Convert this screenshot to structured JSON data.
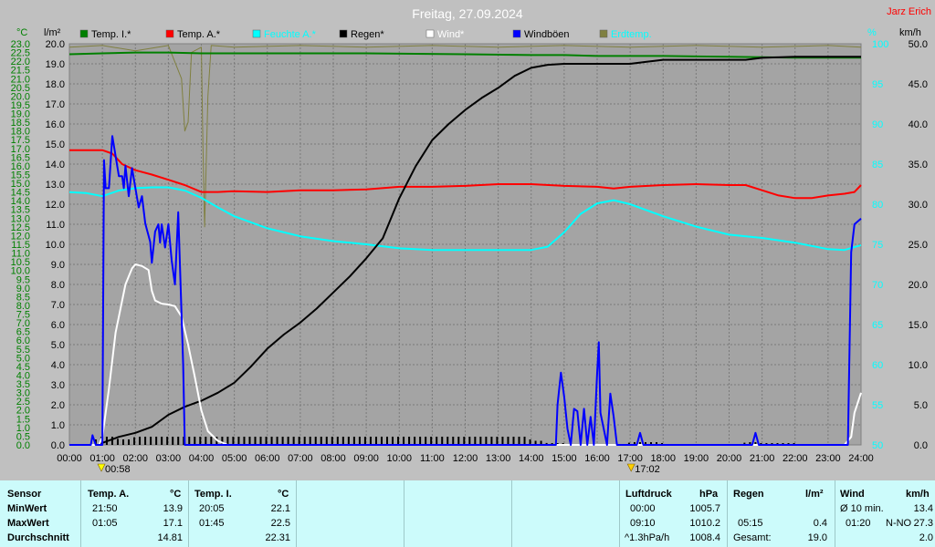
{
  "header": {
    "title": "Freitag, 27.09.2024",
    "author": "Jarz Erich"
  },
  "chart_data": {
    "type": "line",
    "title": "Freitag, 27.09.2024",
    "axes": {
      "temp": {
        "unit": "°C",
        "min": 0,
        "max": 23,
        "step": 0.5,
        "ticks": [
          "0.0",
          "0.5",
          "1.0",
          "1.5",
          "2.0",
          "2.5",
          "3.0",
          "3.5",
          "4.0",
          "4.5",
          "5.0",
          "5.5",
          "6.0",
          "6.5",
          "7.0",
          "7.5",
          "8.0",
          "8.5",
          "9.0",
          "9.5",
          "10.0",
          "10.5",
          "11.0",
          "11.5",
          "12.0",
          "12.5",
          "13.0",
          "13.5",
          "14.0",
          "14.5",
          "15.0",
          "15.5",
          "16.0",
          "16.5",
          "17.0",
          "17.5",
          "18.0",
          "18.5",
          "19.0",
          "19.5",
          "20.0",
          "20.5",
          "21.0",
          "21.5",
          "22.0",
          "22.5",
          "23.0"
        ],
        "color": "#008000"
      },
      "rain": {
        "unit": "l/m²",
        "min": 0,
        "max": 20,
        "step": 1,
        "ticks": [
          "0.0",
          "1.0",
          "2.0",
          "3.0",
          "4.0",
          "5.0",
          "6.0",
          "7.0",
          "8.0",
          "9.0",
          "10.0",
          "11.0",
          "12.0",
          "13.0",
          "14.0",
          "15.0",
          "16.0",
          "17.0",
          "18.0",
          "19.0",
          "20.0"
        ],
        "color": "#000000"
      },
      "humidity": {
        "unit": "%",
        "min": 50,
        "max": 100,
        "step": 5,
        "ticks": [
          "50",
          "55",
          "60",
          "65",
          "70",
          "75",
          "80",
          "85",
          "90",
          "95",
          "100"
        ],
        "color": "#00ffff"
      },
      "wind": {
        "unit": "km/h",
        "min": 0,
        "max": 50,
        "step": 5,
        "ticks": [
          "0.0",
          "5.0",
          "10.0",
          "15.0",
          "20.0",
          "25.0",
          "30.0",
          "35.0",
          "40.0",
          "45.0",
          "50.0"
        ],
        "color": "#000000"
      },
      "x_ticks": [
        "00:00",
        "01:00",
        "02:00",
        "03:00",
        "04:00",
        "05:00",
        "06:00",
        "07:00",
        "08:00",
        "09:00",
        "10:00",
        "11:00",
        "12:00",
        "13:00",
        "14:00",
        "15:00",
        "16:00",
        "17:00",
        "18:00",
        "19:00",
        "20:00",
        "21:00",
        "22:00",
        "23:00",
        "24:00"
      ]
    },
    "legend": [
      {
        "name": "Temp. I.*",
        "color": "#008000"
      },
      {
        "name": "Temp. A.*",
        "color": "#ff0000"
      },
      {
        "name": "Feuchte A.*",
        "color": "#00ffff"
      },
      {
        "name": "Regen*",
        "color": "#000000"
      },
      {
        "name": "Wind*",
        "color": "#ffffff"
      },
      {
        "name": "Windböen",
        "color": "#0000ff"
      },
      {
        "name": "Erdtemp.",
        "color": "#808040"
      }
    ],
    "markers": [
      {
        "label": "00:58",
        "time": 0.97,
        "kind": "sunrise"
      },
      {
        "label": "17:02",
        "time": 17.03,
        "kind": "sunset"
      }
    ],
    "series": [
      {
        "name": "Temp. I.*",
        "axis": "temp",
        "color": "#008000",
        "points": [
          [
            0,
            22.4
          ],
          [
            1,
            22.45
          ],
          [
            2,
            22.5
          ],
          [
            3,
            22.5
          ],
          [
            4,
            22.45
          ],
          [
            6,
            22.45
          ],
          [
            9,
            22.45
          ],
          [
            12,
            22.4
          ],
          [
            14,
            22.35
          ],
          [
            15,
            22.35
          ],
          [
            16,
            22.3
          ],
          [
            18,
            22.3
          ],
          [
            20,
            22.25
          ],
          [
            22,
            22.2
          ],
          [
            24,
            22.2
          ]
        ]
      },
      {
        "name": "Temp. A.*",
        "axis": "temp",
        "color": "#ff0000",
        "points": [
          [
            0,
            16.9
          ],
          [
            0.5,
            16.9
          ],
          [
            1,
            16.9
          ],
          [
            1.3,
            16.7
          ],
          [
            1.6,
            16.1
          ],
          [
            2,
            15.75
          ],
          [
            2.5,
            15.5
          ],
          [
            3,
            15.2
          ],
          [
            3.5,
            14.9
          ],
          [
            4,
            14.5
          ],
          [
            4.5,
            14.5
          ],
          [
            5,
            14.55
          ],
          [
            6,
            14.5
          ],
          [
            7,
            14.6
          ],
          [
            8,
            14.6
          ],
          [
            9,
            14.65
          ],
          [
            10,
            14.8
          ],
          [
            11,
            14.8
          ],
          [
            12,
            14.85
          ],
          [
            13,
            14.95
          ],
          [
            14,
            14.95
          ],
          [
            15,
            14.85
          ],
          [
            16,
            14.8
          ],
          [
            16.5,
            14.7
          ],
          [
            17,
            14.8
          ],
          [
            18,
            14.9
          ],
          [
            19,
            14.95
          ],
          [
            20,
            14.9
          ],
          [
            20.5,
            14.9
          ],
          [
            21,
            14.6
          ],
          [
            21.5,
            14.3
          ],
          [
            22,
            14.15
          ],
          [
            22.5,
            14.15
          ],
          [
            23,
            14.3
          ],
          [
            23.5,
            14.4
          ],
          [
            23.8,
            14.5
          ],
          [
            24,
            14.9
          ]
        ]
      },
      {
        "name": "Feuchte A.*",
        "axis": "humidity",
        "color": "#00ffff",
        "points": [
          [
            0,
            81.5
          ],
          [
            0.5,
            81.4
          ],
          [
            1,
            81
          ],
          [
            1.5,
            81.7
          ],
          [
            2,
            82
          ],
          [
            2.5,
            82.1
          ],
          [
            3,
            82.1
          ],
          [
            3.5,
            81.7
          ],
          [
            4,
            80.8
          ],
          [
            4.5,
            79.6
          ],
          [
            5,
            78.5
          ],
          [
            6,
            77
          ],
          [
            7,
            76
          ],
          [
            8,
            75.4
          ],
          [
            9,
            75
          ],
          [
            10,
            74.5
          ],
          [
            11,
            74.3
          ],
          [
            12,
            74.3
          ],
          [
            13,
            74.3
          ],
          [
            14,
            74.3
          ],
          [
            14.5,
            74.7
          ],
          [
            15,
            76.5
          ],
          [
            15.5,
            78.8
          ],
          [
            16,
            80.1
          ],
          [
            16.5,
            80.5
          ],
          [
            17,
            80
          ],
          [
            18,
            78.5
          ],
          [
            19,
            77.2
          ],
          [
            20,
            76.2
          ],
          [
            21,
            75.8
          ],
          [
            22,
            75.2
          ],
          [
            23,
            74.4
          ],
          [
            23.5,
            74.3
          ],
          [
            24,
            74.9
          ]
        ]
      },
      {
        "name": "Regen*",
        "axis": "rain",
        "color": "#000000",
        "points": [
          [
            0,
            0
          ],
          [
            0.9,
            0
          ],
          [
            1,
            0.1
          ],
          [
            1.5,
            0.4
          ],
          [
            2,
            0.6
          ],
          [
            2.5,
            0.9
          ],
          [
            3,
            1.5
          ],
          [
            3.5,
            1.9
          ],
          [
            4,
            2.2
          ],
          [
            4.5,
            2.6
          ],
          [
            5,
            3.1
          ],
          [
            5.5,
            3.9
          ],
          [
            6,
            4.8
          ],
          [
            6.5,
            5.5
          ],
          [
            7,
            6.1
          ],
          [
            7.5,
            6.8
          ],
          [
            8,
            7.6
          ],
          [
            8.5,
            8.4
          ],
          [
            9,
            9.3
          ],
          [
            9.5,
            10.3
          ],
          [
            10,
            12.3
          ],
          [
            10.5,
            13.9
          ],
          [
            11,
            15.2
          ],
          [
            11.5,
            16
          ],
          [
            12,
            16.7
          ],
          [
            12.5,
            17.3
          ],
          [
            13,
            17.8
          ],
          [
            13.5,
            18.4
          ],
          [
            14,
            18.8
          ],
          [
            14.5,
            18.95
          ],
          [
            15,
            19
          ],
          [
            16,
            19
          ],
          [
            17,
            19.0
          ],
          [
            17.5,
            19.1
          ],
          [
            18,
            19.2
          ],
          [
            20,
            19.2
          ],
          [
            20.5,
            19.2
          ],
          [
            21,
            19.3
          ],
          [
            22,
            19.35
          ],
          [
            24,
            19.35
          ]
        ]
      },
      {
        "name": "Wind*",
        "axis": "wind",
        "color": "#ffffff",
        "points": [
          [
            0,
            0
          ],
          [
            0.9,
            0
          ],
          [
            1,
            1
          ],
          [
            1.2,
            7
          ],
          [
            1.4,
            14
          ],
          [
            1.7,
            20
          ],
          [
            1.9,
            22
          ],
          [
            2,
            22.5
          ],
          [
            2.2,
            22.3
          ],
          [
            2.4,
            21.8
          ],
          [
            2.5,
            19.2
          ],
          [
            2.6,
            18
          ],
          [
            2.8,
            17.6
          ],
          [
            3,
            17.5
          ],
          [
            3.2,
            17.3
          ],
          [
            3.4,
            16
          ],
          [
            3.6,
            12.5
          ],
          [
            3.8,
            8.5
          ],
          [
            4,
            4.3
          ],
          [
            4.2,
            1.7
          ],
          [
            4.5,
            0.5
          ],
          [
            4.8,
            0
          ],
          [
            23.5,
            0
          ],
          [
            23.7,
            1
          ],
          [
            23.8,
            4
          ],
          [
            24,
            6.5
          ]
        ]
      },
      {
        "name": "Windböen",
        "axis": "wind",
        "color": "#0000ff",
        "points": [
          [
            0,
            0
          ],
          [
            0.65,
            0
          ],
          [
            0.7,
            1.2
          ],
          [
            0.8,
            0
          ],
          [
            1,
            0
          ],
          [
            1.05,
            35.5
          ],
          [
            1.1,
            32
          ],
          [
            1.2,
            32
          ],
          [
            1.3,
            38.5
          ],
          [
            1.4,
            36
          ],
          [
            1.5,
            33.5
          ],
          [
            1.6,
            33.5
          ],
          [
            1.65,
            32
          ],
          [
            1.7,
            34.8
          ],
          [
            1.8,
            31
          ],
          [
            1.9,
            34.5
          ],
          [
            2,
            32
          ],
          [
            2.1,
            29.6
          ],
          [
            2.2,
            31
          ],
          [
            2.3,
            27.6
          ],
          [
            2.45,
            25.3
          ],
          [
            2.5,
            22.7
          ],
          [
            2.6,
            26.6
          ],
          [
            2.7,
            27.5
          ],
          [
            2.75,
            25.2
          ],
          [
            2.8,
            27.5
          ],
          [
            2.9,
            24.6
          ],
          [
            3,
            27.5
          ],
          [
            3.1,
            23
          ],
          [
            3.2,
            20
          ],
          [
            3.3,
            29
          ],
          [
            3.45,
            10
          ],
          [
            3.5,
            0
          ],
          [
            14.75,
            0
          ],
          [
            14.8,
            5
          ],
          [
            14.9,
            9
          ],
          [
            15,
            6
          ],
          [
            15.1,
            2
          ],
          [
            15.2,
            0
          ],
          [
            15.3,
            4.5
          ],
          [
            15.4,
            4.2
          ],
          [
            15.5,
            0
          ],
          [
            15.6,
            4.5
          ],
          [
            15.7,
            0
          ],
          [
            15.8,
            3.5
          ],
          [
            15.9,
            0
          ],
          [
            16,
            9
          ],
          [
            16.05,
            12.8
          ],
          [
            16.1,
            4
          ],
          [
            16.2,
            2
          ],
          [
            16.3,
            0
          ],
          [
            16.35,
            3.2
          ],
          [
            16.4,
            6.4
          ],
          [
            16.5,
            3.5
          ],
          [
            16.6,
            0
          ],
          [
            17.2,
            0
          ],
          [
            17.3,
            1.5
          ],
          [
            17.4,
            0
          ],
          [
            20.7,
            0
          ],
          [
            20.8,
            1.5
          ],
          [
            20.9,
            0
          ],
          [
            23.6,
            0
          ],
          [
            23.7,
            24
          ],
          [
            23.8,
            27.5
          ],
          [
            24,
            28.2
          ]
        ]
      },
      {
        "name": "Erdtemp.",
        "axis": "temp",
        "color": "#808040",
        "points": [
          [
            0,
            22.8
          ],
          [
            1,
            22.9
          ],
          [
            2,
            22.6
          ],
          [
            3,
            22.9
          ],
          [
            3.4,
            21
          ],
          [
            3.5,
            18
          ],
          [
            3.6,
            18.5
          ],
          [
            3.7,
            22.5
          ],
          [
            4,
            22.8
          ],
          [
            4.05,
            17
          ],
          [
            4.1,
            12.5
          ],
          [
            4.2,
            20
          ],
          [
            4.3,
            22.9
          ],
          [
            5,
            22.8
          ],
          [
            7,
            22.9
          ],
          [
            9,
            22.8
          ],
          [
            11,
            22.9
          ],
          [
            13,
            22.8
          ],
          [
            15,
            22.9
          ],
          [
            17,
            22.8
          ],
          [
            19,
            22.9
          ],
          [
            21,
            22.8
          ],
          [
            23,
            22.9
          ],
          [
            24,
            22.8
          ]
        ]
      }
    ]
  },
  "table": {
    "sensor": {
      "header": "Sensor",
      "rows": [
        "MinWert",
        "MaxWert",
        "Durchschnitt"
      ]
    },
    "temp_a": {
      "header": "Temp. A.",
      "unit": "°C",
      "min_time": "21:50",
      "min_val": "13.9",
      "max_time": "01:05",
      "max_val": "17.1",
      "avg": "14.81"
    },
    "temp_i": {
      "header": "Temp. I.",
      "unit": "°C",
      "min_time": "20:05",
      "min_val": "22.1",
      "max_time": "01:45",
      "max_val": "22.5",
      "avg": "22.31"
    },
    "luftdruck": {
      "header": "Luftdruck",
      "unit": "hPa",
      "min_time": "00:00",
      "min_val": "1005.7",
      "max_time": "09:10",
      "max_val": "1010.2",
      "trend_label": "^1.3hPa/h",
      "trend_val": "1008.4"
    },
    "regen": {
      "header": "Regen",
      "unit": "l/m²",
      "max_time": "05:15",
      "max_val": "0.4",
      "total_label": "Gesamt:",
      "total_val": "19.0"
    },
    "wind": {
      "header": "Wind",
      "unit": "km/h",
      "avg_label": "Ø 10 min.",
      "avg_val": "13.4",
      "max_time": "01:20",
      "max_dir": "N-NO",
      "max_val": "27.3",
      "mean_val": "2.0"
    }
  }
}
